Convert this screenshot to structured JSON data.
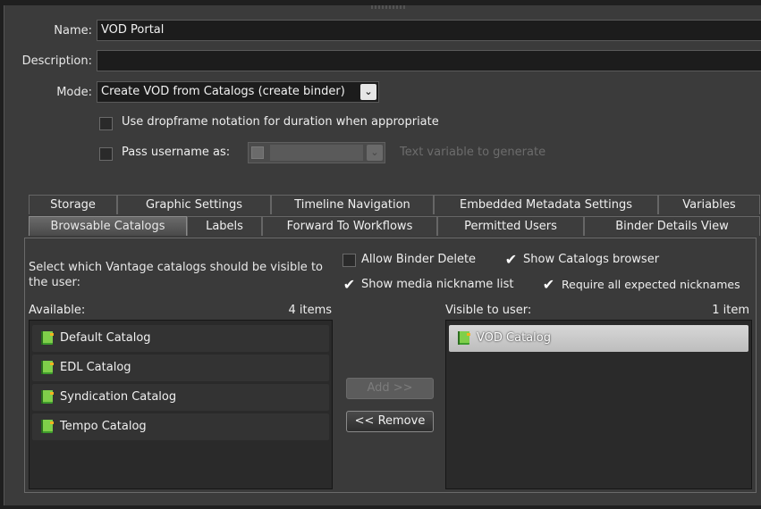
{
  "form": {
    "name_label": "Name:",
    "name_value": "VOD Portal",
    "description_label": "Description:",
    "description_value": "",
    "mode_label": "Mode:",
    "mode_value": "Create VOD from Catalogs (create binder)",
    "dropframe_label": "Use dropframe notation for duration when appropriate",
    "dropframe_checked": false,
    "pass_username_label": "Pass username as:",
    "pass_username_checked": false,
    "text_variable_hint": "Text variable to generate"
  },
  "tabs": {
    "row1": [
      "Storage",
      "Graphic Settings",
      "Timeline Navigation",
      "Embedded Metadata Settings",
      "Variables"
    ],
    "row2": [
      "Browsable Catalogs",
      "Labels",
      "Forward To Workflows",
      "Permitted Users",
      "Binder Details View"
    ],
    "active": "Browsable Catalogs"
  },
  "catalogs": {
    "description": "Select which Vantage catalogs should be visible to the user:",
    "allow_binder_delete": "Allow Binder Delete",
    "allow_binder_delete_checked": false,
    "show_catalogs_browser": "Show Catalogs browser",
    "show_catalogs_browser_checked": true,
    "show_media_nickname": "Show media nickname list",
    "show_media_nickname_checked": true,
    "require_nicknames": "Require all expected nicknames",
    "require_nicknames_checked": true,
    "available_label": "Available:",
    "available_count": "4 items",
    "available_items": [
      "Default Catalog",
      "EDL Catalog",
      "Syndication Catalog",
      "Tempo Catalog"
    ],
    "visible_label": "Visible to user:",
    "visible_count": "1 item",
    "visible_items": [
      "VOD Catalog"
    ],
    "add_button": "Add >>",
    "remove_button": "<< Remove"
  },
  "icons": {
    "catalog": "catalog-book-icon",
    "dropdown": "chevron-down-icon",
    "variable": "variable-list-icon"
  }
}
